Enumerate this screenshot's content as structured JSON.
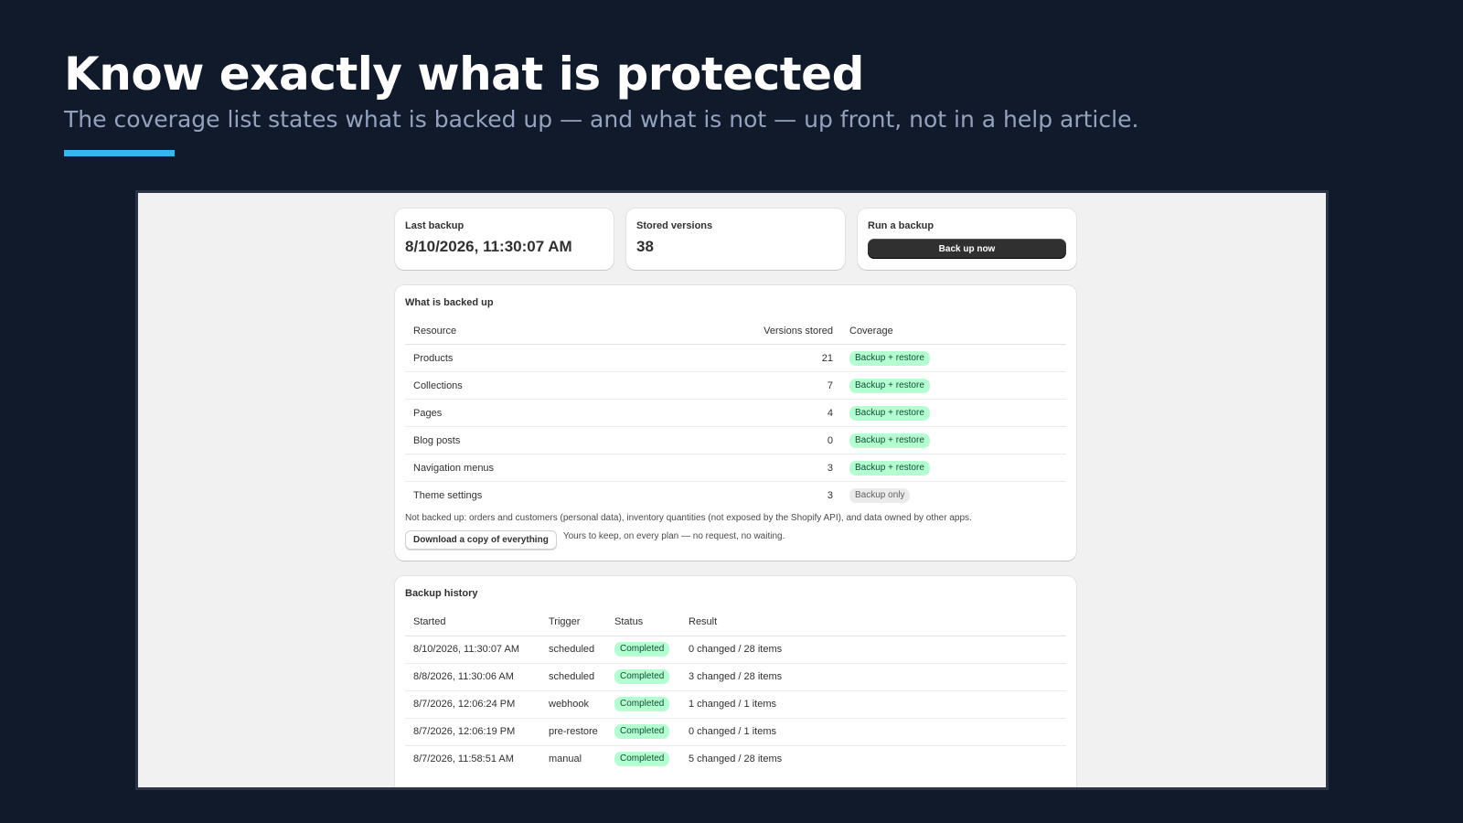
{
  "slide": {
    "title": "Know exactly what is protected",
    "subtitle": "The coverage list states what is backed up — and what is not — up front, not in a help article.",
    "accent_color": "#38b6f0"
  },
  "stats": {
    "last_backup_label": "Last backup",
    "last_backup_value": "8/10/2026, 11:30:07 AM",
    "stored_versions_label": "Stored versions",
    "stored_versions_value": "38",
    "run_label": "Run a backup",
    "run_button": "Back up now"
  },
  "coverage": {
    "title": "What is backed up",
    "columns": [
      "Resource",
      "Versions stored",
      "Coverage"
    ],
    "rows": [
      {
        "resource": "Products",
        "versions": "21",
        "coverage": "Backup + restore"
      },
      {
        "resource": "Collections",
        "versions": "7",
        "coverage": "Backup + restore"
      },
      {
        "resource": "Pages",
        "versions": "4",
        "coverage": "Backup + restore"
      },
      {
        "resource": "Blog posts",
        "versions": "0",
        "coverage": "Backup + restore"
      },
      {
        "resource": "Navigation menus",
        "versions": "3",
        "coverage": "Backup + restore"
      },
      {
        "resource": "Theme settings",
        "versions": "3",
        "coverage": "Backup only"
      }
    ],
    "not_backed_up_note": "Not backed up: orders and customers (personal data), inventory quantities (not exposed by the Shopify API), and data owned by other apps.",
    "download_button": "Download a copy of everything",
    "download_hint": "Yours to keep, on every plan — no request, no waiting."
  },
  "history": {
    "title": "Backup history",
    "columns": [
      "Started",
      "Trigger",
      "Status",
      "Result"
    ],
    "rows": [
      {
        "started": "8/10/2026, 11:30:07 AM",
        "trigger": "scheduled",
        "status": "Completed",
        "result": "0 changed / 28 items"
      },
      {
        "started": "8/8/2026, 11:30:06 AM",
        "trigger": "scheduled",
        "status": "Completed",
        "result": "3 changed / 28 items"
      },
      {
        "started": "8/7/2026, 12:06:24 PM",
        "trigger": "webhook",
        "status": "Completed",
        "result": "1 changed / 1 items"
      },
      {
        "started": "8/7/2026, 12:06:19 PM",
        "trigger": "pre-restore",
        "status": "Completed",
        "result": "0 changed / 1 items"
      },
      {
        "started": "8/7/2026, 11:58:51 AM",
        "trigger": "manual",
        "status": "Completed",
        "result": "5 changed / 28 items"
      }
    ]
  }
}
